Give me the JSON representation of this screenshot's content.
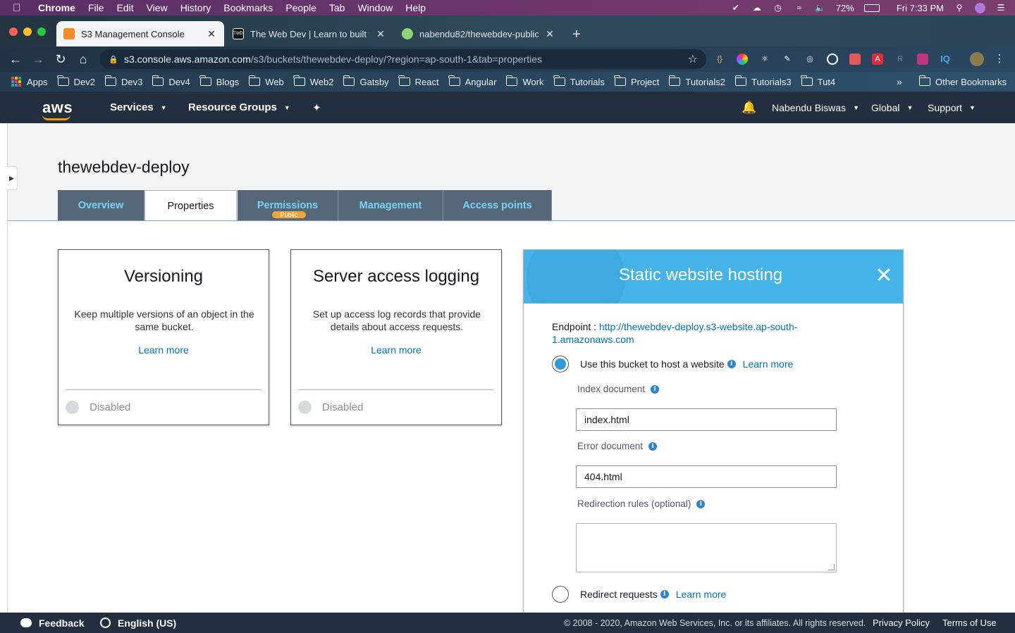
{
  "menubar": {
    "app": "Chrome",
    "items": [
      "File",
      "Edit",
      "View",
      "History",
      "Bookmarks",
      "People",
      "Tab",
      "Window",
      "Help"
    ],
    "battery": "72%",
    "clock": "Fri 7:33 PM"
  },
  "tabs": [
    {
      "title": "S3 Management Console",
      "favicon_color": "#f28b2c"
    },
    {
      "title": "The Web Dev | Learn to built w",
      "favicon_color": "#111111"
    },
    {
      "title": "nabendu82/thewebdev-public",
      "favicon_color": "#8fd37a"
    }
  ],
  "omnibox": {
    "host": "s3.console.aws.amazon.com",
    "path": "/s3/buckets/thewebdev-deploy/?region=ap-south-1&tab=properties"
  },
  "bookmarks": {
    "apps_label": "Apps",
    "folders": [
      "Dev2",
      "Dev3",
      "Dev4",
      "Blogs",
      "Web",
      "Web2",
      "Gatsby",
      "React",
      "Angular",
      "Work",
      "Tutorials",
      "Project",
      "Tutorials2",
      "Tutorials3",
      "Tut4"
    ],
    "overflow": "»",
    "other": "Other Bookmarks"
  },
  "aws_nav": {
    "logo": "aws",
    "services": "Services",
    "resource_groups": "Resource Groups",
    "user": "Nabendu Biswas",
    "region": "Global",
    "support": "Support"
  },
  "bucket": {
    "name": "thewebdev-deploy"
  },
  "s3_tabs": [
    {
      "label": "Overview"
    },
    {
      "label": "Properties",
      "active": true
    },
    {
      "label": "Permissions",
      "badge": "Public"
    },
    {
      "label": "Management"
    },
    {
      "label": "Access points"
    }
  ],
  "cards": [
    {
      "title": "Versioning",
      "description": "Keep multiple versions of an object in the same bucket.",
      "link": "Learn more",
      "status": "Disabled"
    },
    {
      "title": "Server access logging",
      "description": "Set up access log records that provide details about access requests.",
      "link": "Learn more",
      "status": "Disabled"
    }
  ],
  "hosting": {
    "title": "Static website hosting",
    "endpoint_label": "Endpoint : ",
    "endpoint_url": "http://thewebdev-deploy.s3-website.ap-south-1.amazonaws.com",
    "use_bucket_label": "Use this bucket to host a website",
    "use_bucket_link": "Learn more",
    "index_label": "Index document",
    "index_value": "index.html",
    "error_label": "Error document",
    "error_value": "404.html",
    "redirection_label": "Redirection rules (optional)",
    "redirection_value": "",
    "redirect_label": "Redirect requests",
    "redirect_link": "Learn more"
  },
  "footer": {
    "feedback": "Feedback",
    "language": "English (US)",
    "copyright": "© 2008 - 2020, Amazon Web Services, Inc. or its affiliates. All rights reserved.",
    "privacy": "Privacy Policy",
    "terms": "Terms of Use"
  }
}
